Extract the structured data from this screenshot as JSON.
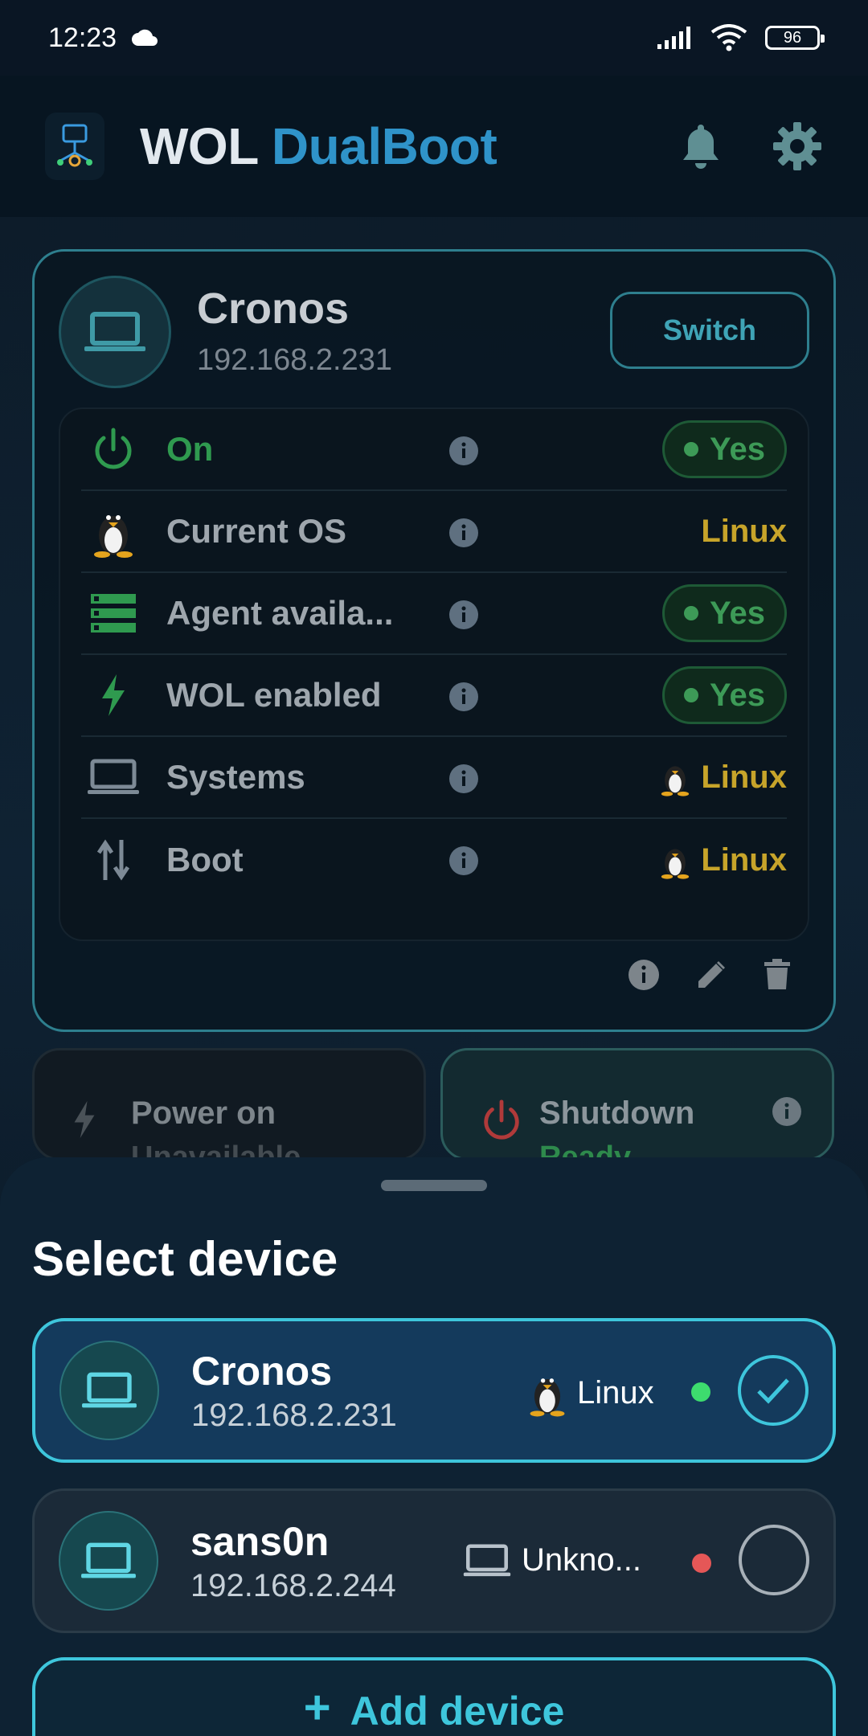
{
  "status_bar": {
    "time": "12:23",
    "battery": "96"
  },
  "app": {
    "title_part1": "WOL",
    "title_part2": "DualBoot"
  },
  "device_card": {
    "name": "Cronos",
    "ip": "192.168.2.231",
    "switch_label": "Switch",
    "rows": [
      {
        "label": "On",
        "value": "Yes",
        "icon": "power-icon"
      },
      {
        "label": "Current OS",
        "value": "Linux",
        "icon": "penguin-icon"
      },
      {
        "label": "Agent availa...",
        "value": "Yes",
        "icon": "server-icon"
      },
      {
        "label": "WOL enabled",
        "value": "Yes",
        "icon": "bolt-icon"
      },
      {
        "label": "Systems",
        "value": "Linux",
        "icon": "laptop-icon"
      },
      {
        "label": "Boot",
        "value": "Linux",
        "icon": "swap-vert-icon"
      }
    ]
  },
  "action_tiles": {
    "power_on": {
      "title": "Power on",
      "subtitle": "Unavailable"
    },
    "shutdown": {
      "title": "Shutdown",
      "subtitle": "Ready"
    }
  },
  "sheet": {
    "title": "Select device",
    "devices": [
      {
        "name": "Cronos",
        "ip": "192.168.2.231",
        "os": "Linux",
        "status_color": "#3ddc6e",
        "selected": true
      },
      {
        "name": "sans0n",
        "ip": "192.168.2.244",
        "os": "Unkno...",
        "status_color": "#e55757",
        "selected": false
      }
    ],
    "add_label": "Add device"
  },
  "colors": {
    "accent": "#3ec6dc",
    "linux": "#c7a42a",
    "ok": "#3d9a57",
    "danger": "#c0392b"
  }
}
